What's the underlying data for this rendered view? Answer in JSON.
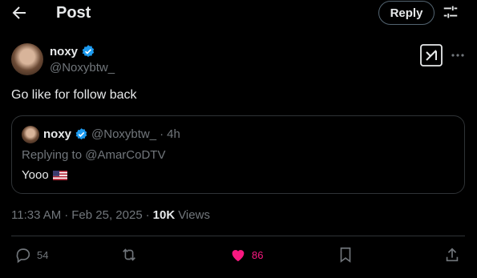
{
  "header": {
    "title": "Post",
    "reply_button": "Reply",
    "back_icon": "back-arrow-icon",
    "adjust_icon": "sliders-icon"
  },
  "author": {
    "name": "noxy",
    "handle": "@Noxybtw_",
    "verified_color": "#1d9bf0"
  },
  "post": {
    "text": "Go like for follow back"
  },
  "quote": {
    "name": "noxy",
    "handle": "@Noxybtw_",
    "separator": "·",
    "time": "4h",
    "replying_to": "Replying to @AmarCoDTV",
    "text": "Yooo"
  },
  "meta": {
    "time": "11:33 AM",
    "sep1": "·",
    "date": "Feb 25, 2025",
    "sep2": "·",
    "views_count": "10K",
    "views_label": "Views"
  },
  "actions": {
    "replies": "54",
    "likes": "86",
    "like_color": "#f91880"
  }
}
